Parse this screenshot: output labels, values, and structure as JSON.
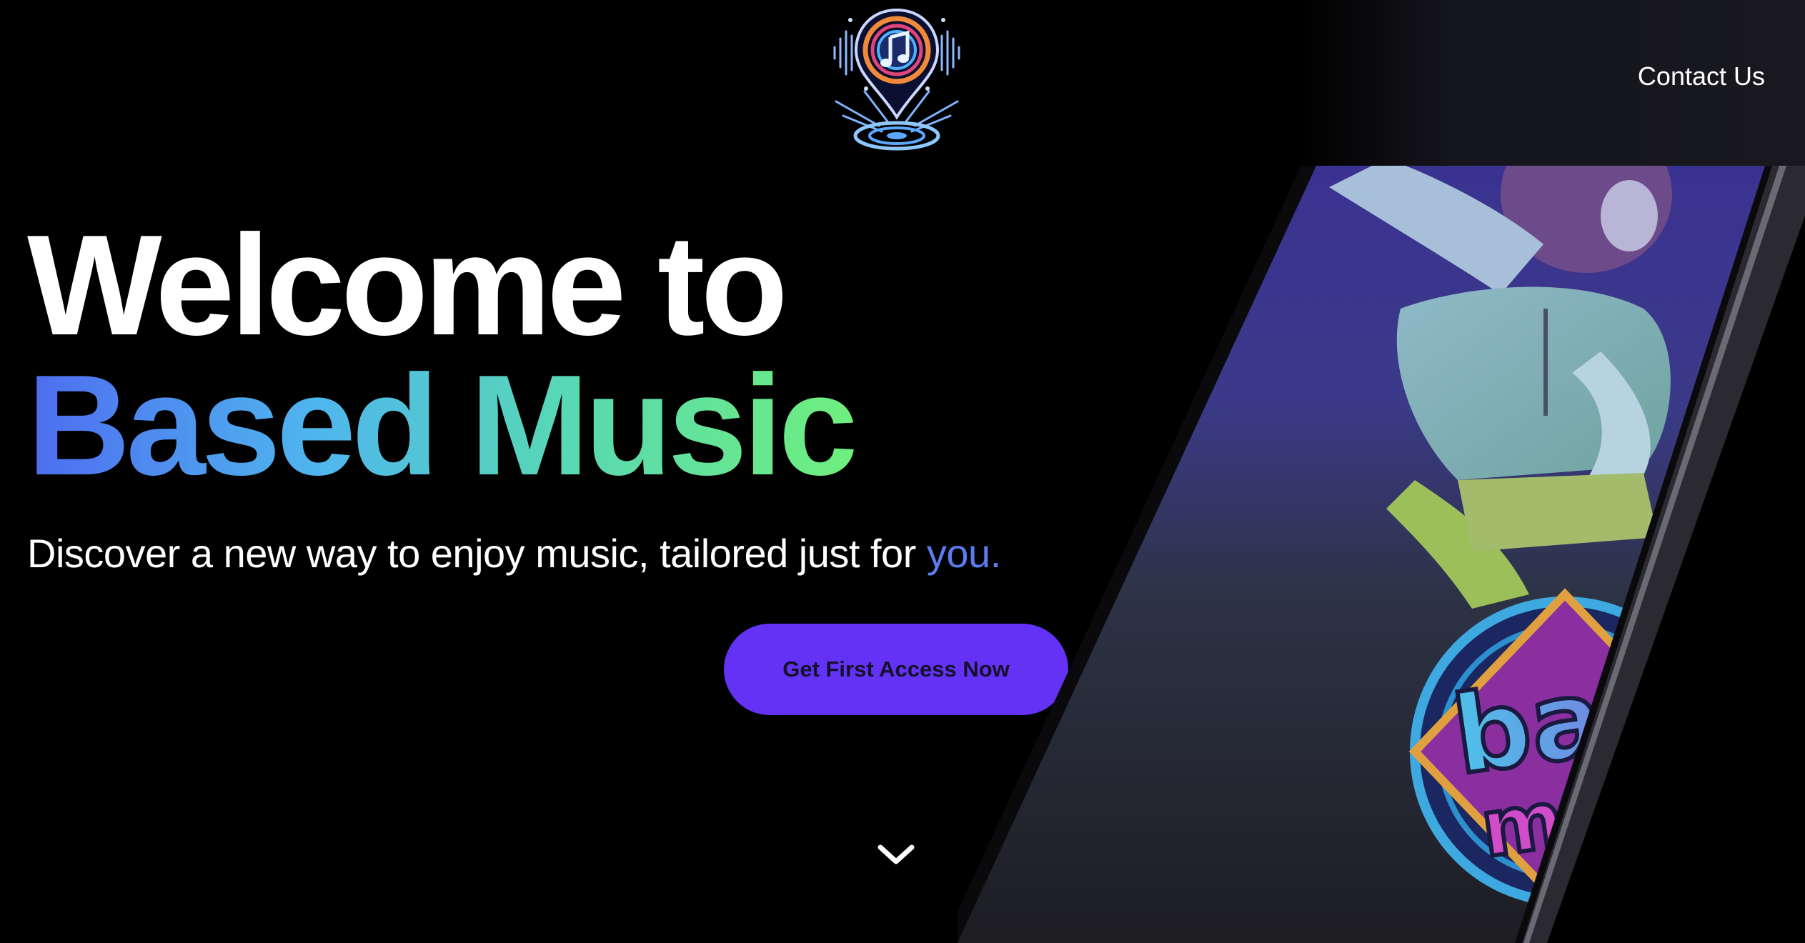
{
  "header": {
    "logo_icon": "music-note-pin-logo-icon",
    "contact_label": "Contact Us"
  },
  "hero": {
    "title_line1": "Welcome to",
    "title_line2": "Based Music",
    "subtitle_main": "Discover a new way to enjoy music, tailored just for ",
    "subtitle_accent": "you.",
    "cta_label": "Get First Access Now",
    "scroll_icon": "chevron-down-icon"
  },
  "phone_screen": {
    "logo_word_1": "based",
    "logo_word_2": "music"
  },
  "colors": {
    "background": "#000000",
    "button": "#6332f5",
    "accent_blue": "#5b7bf0",
    "gradient_start": "#4e6cf0",
    "gradient_end": "#6fef7c"
  }
}
